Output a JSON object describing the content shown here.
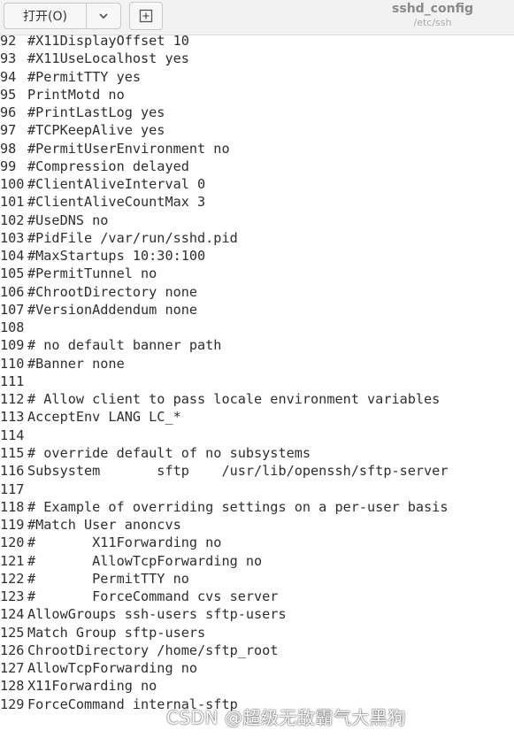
{
  "toolbar": {
    "open_label": "打开(O)",
    "dropdown_icon": "chevron-down-icon",
    "new_document_icon": "new-document-icon"
  },
  "header": {
    "title": "sshd_config",
    "subtitle": "/etc/ssh"
  },
  "editor": {
    "lines": [
      {
        "num": "92",
        "text": "#X11DisplayOffset 10"
      },
      {
        "num": "93",
        "text": "#X11UseLocalhost yes"
      },
      {
        "num": "94",
        "text": "#PermitTTY yes"
      },
      {
        "num": "95",
        "text": "PrintMotd no"
      },
      {
        "num": "96",
        "text": "#PrintLastLog yes"
      },
      {
        "num": "97",
        "text": "#TCPKeepAlive yes"
      },
      {
        "num": "98",
        "text": "#PermitUserEnvironment no"
      },
      {
        "num": "99",
        "text": "#Compression delayed"
      },
      {
        "num": "100",
        "text": "#ClientAliveInterval 0"
      },
      {
        "num": "101",
        "text": "#ClientAliveCountMax 3"
      },
      {
        "num": "102",
        "text": "#UseDNS no"
      },
      {
        "num": "103",
        "text": "#PidFile /var/run/sshd.pid"
      },
      {
        "num": "104",
        "text": "#MaxStartups 10:30:100"
      },
      {
        "num": "105",
        "text": "#PermitTunnel no"
      },
      {
        "num": "106",
        "text": "#ChrootDirectory none"
      },
      {
        "num": "107",
        "text": "#VersionAddendum none"
      },
      {
        "num": "108",
        "text": ""
      },
      {
        "num": "109",
        "text": "# no default banner path"
      },
      {
        "num": "110",
        "text": "#Banner none"
      },
      {
        "num": "111",
        "text": ""
      },
      {
        "num": "112",
        "text": "# Allow client to pass locale environment variables"
      },
      {
        "num": "113",
        "text": "AcceptEnv LANG LC_*"
      },
      {
        "num": "114",
        "text": ""
      },
      {
        "num": "115",
        "text": "# override default of no subsystems"
      },
      {
        "num": "116",
        "text": "Subsystem       sftp    /usr/lib/openssh/sftp-server"
      },
      {
        "num": "117",
        "text": ""
      },
      {
        "num": "118",
        "text": "# Example of overriding settings on a per-user basis"
      },
      {
        "num": "119",
        "text": "#Match User anoncvs"
      },
      {
        "num": "120",
        "text": "#       X11Forwarding no"
      },
      {
        "num": "121",
        "text": "#       AllowTcpForwarding no"
      },
      {
        "num": "122",
        "text": "#       PermitTTY no"
      },
      {
        "num": "123",
        "text": "#       ForceCommand cvs server"
      },
      {
        "num": "124",
        "text": "AllowGroups ssh-users sftp-users"
      },
      {
        "num": "125",
        "text": "Match Group sftp-users"
      },
      {
        "num": "126",
        "text": "ChrootDirectory /home/sftp_root"
      },
      {
        "num": "127",
        "text": "AllowTcpForwarding no"
      },
      {
        "num": "128",
        "text": "X11Forwarding no"
      },
      {
        "num": "129",
        "text": "ForceCommand internal-sftp"
      }
    ]
  },
  "watermark": "CSDN @超级无敌霸气大黑狗"
}
